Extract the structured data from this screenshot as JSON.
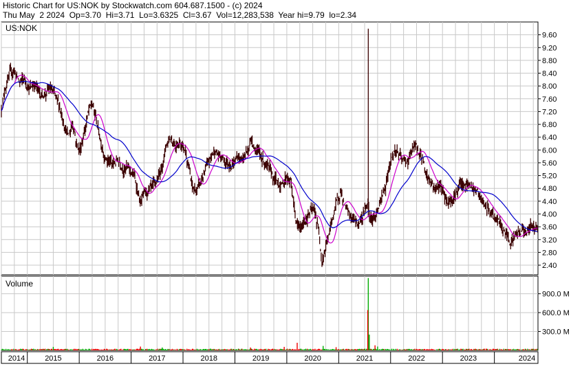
{
  "header": {
    "line1": "Historic Chart for US:NOK by Stockwatch.com 604.687.1500 - (c) 2024",
    "line2": "Thu May  2 2024  Op=3.70  Hi=3.71  Lo=3.6325  Cl=3.67  Vol=12,283,538  Year hi=9.79  lo=2.34"
  },
  "colors": {
    "candle": "#3a0000",
    "ma_short": "#cc00cc",
    "ma_long": "#0000cc",
    "vol_up": "#00aa00",
    "vol_down": "#ee0000",
    "grid": "#c8c8c8",
    "frame": "#000000"
  },
  "chart_data": [
    {
      "type": "line",
      "panel_label": "US:NOK",
      "y_ticks": [
        "9.60",
        "9.20",
        "8.80",
        "8.40",
        "8.00",
        "7.60",
        "7.20",
        "6.80",
        "6.40",
        "6.00",
        "5.60",
        "5.20",
        "4.80",
        "4.40",
        "4.00",
        "3.60",
        "3.20",
        "2.80",
        "2.40"
      ],
      "ylim": [
        2.1,
        10.0
      ],
      "x_ticks": [
        "2014",
        "2015",
        "2016",
        "2017",
        "2018",
        "2019",
        "2020",
        "2021",
        "2022",
        "2023",
        "2024"
      ],
      "x_tick_values": [
        2014.0,
        2015.0,
        2016.0,
        2017.0,
        2018.0,
        2019.0,
        2020.0,
        2021.0,
        2022.0,
        2023.0,
        2024.0
      ],
      "xlim": [
        2014.0,
        2024.34
      ],
      "price_series": [
        [
          2014.0,
          7.3
        ],
        [
          2014.08,
          8.0
        ],
        [
          2014.15,
          8.3
        ],
        [
          2014.25,
          8.5
        ],
        [
          2014.35,
          8.1
        ],
        [
          2014.45,
          8.2
        ],
        [
          2014.55,
          7.9
        ],
        [
          2014.65,
          8.1
        ],
        [
          2014.75,
          7.7
        ],
        [
          2014.85,
          7.8
        ],
        [
          2014.95,
          7.9
        ],
        [
          2015.05,
          7.6
        ],
        [
          2015.15,
          7.2
        ],
        [
          2015.22,
          6.8
        ],
        [
          2015.3,
          6.4
        ],
        [
          2015.38,
          6.9
        ],
        [
          2015.45,
          6.2
        ],
        [
          2015.52,
          6.0
        ],
        [
          2015.6,
          6.6
        ],
        [
          2015.68,
          7.2
        ],
        [
          2015.75,
          7.4
        ],
        [
          2015.82,
          7.0
        ],
        [
          2015.9,
          6.4
        ],
        [
          2015.98,
          5.9
        ],
        [
          2016.05,
          5.7
        ],
        [
          2016.15,
          5.5
        ],
        [
          2016.25,
          5.7
        ],
        [
          2016.35,
          5.5
        ],
        [
          2016.45,
          5.4
        ],
        [
          2016.55,
          5.2
        ],
        [
          2016.62,
          4.8
        ],
        [
          2016.68,
          4.3
        ],
        [
          2016.75,
          4.6
        ],
        [
          2016.85,
          4.7
        ],
        [
          2016.95,
          4.8
        ],
        [
          2017.05,
          5.2
        ],
        [
          2017.12,
          5.7
        ],
        [
          2017.18,
          6.2
        ],
        [
          2017.25,
          6.4
        ],
        [
          2017.35,
          6.2
        ],
        [
          2017.45,
          6.3
        ],
        [
          2017.55,
          6.0
        ],
        [
          2017.62,
          5.4
        ],
        [
          2017.68,
          4.8
        ],
        [
          2017.75,
          4.7
        ],
        [
          2017.85,
          5.0
        ],
        [
          2017.95,
          5.4
        ],
        [
          2018.05,
          5.8
        ],
        [
          2018.12,
          6.0
        ],
        [
          2018.2,
          5.8
        ],
        [
          2018.28,
          5.7
        ],
        [
          2018.38,
          5.6
        ],
        [
          2018.48,
          5.6
        ],
        [
          2018.55,
          5.8
        ],
        [
          2018.65,
          5.7
        ],
        [
          2018.75,
          6.0
        ],
        [
          2018.82,
          6.4
        ],
        [
          2018.88,
          6.1
        ],
        [
          2018.95,
          5.9
        ],
        [
          2019.05,
          5.7
        ],
        [
          2019.12,
          5.5
        ],
        [
          2019.2,
          5.2
        ],
        [
          2019.3,
          5.0
        ],
        [
          2019.4,
          4.9
        ],
        [
          2019.5,
          5.2
        ],
        [
          2019.58,
          5.0
        ],
        [
          2019.64,
          4.2
        ],
        [
          2019.7,
          3.6
        ],
        [
          2019.78,
          3.5
        ],
        [
          2019.85,
          3.8
        ],
        [
          2019.92,
          4.0
        ],
        [
          2019.98,
          4.1
        ],
        [
          2020.05,
          4.0
        ],
        [
          2020.12,
          3.4
        ],
        [
          2020.18,
          2.6
        ],
        [
          2020.25,
          3.0
        ],
        [
          2020.32,
          3.4
        ],
        [
          2020.4,
          4.0
        ],
        [
          2020.48,
          4.4
        ],
        [
          2020.55,
          4.8
        ],
        [
          2020.58,
          4.4
        ],
        [
          2020.65,
          4.1
        ],
        [
          2020.72,
          3.9
        ],
        [
          2020.8,
          3.8
        ],
        [
          2020.88,
          3.7
        ],
        [
          2020.95,
          3.9
        ],
        [
          2021.0,
          4.1
        ],
        [
          2021.06,
          4.4
        ],
        [
          2021.1,
          4.0
        ],
        [
          2021.18,
          3.9
        ],
        [
          2021.25,
          4.1
        ],
        [
          2021.32,
          4.4
        ],
        [
          2021.4,
          4.8
        ],
        [
          2021.48,
          5.6
        ],
        [
          2021.55,
          5.9
        ],
        [
          2021.62,
          6.0
        ],
        [
          2021.7,
          5.7
        ],
        [
          2021.78,
          5.6
        ],
        [
          2021.85,
          5.7
        ],
        [
          2021.92,
          6.0
        ],
        [
          2021.98,
          6.1
        ],
        [
          2022.05,
          5.9
        ],
        [
          2022.12,
          5.7
        ],
        [
          2022.2,
          5.2
        ],
        [
          2022.28,
          5.0
        ],
        [
          2022.36,
          4.8
        ],
        [
          2022.44,
          4.9
        ],
        [
          2022.52,
          4.7
        ],
        [
          2022.6,
          4.4
        ],
        [
          2022.68,
          4.5
        ],
        [
          2022.76,
          4.7
        ],
        [
          2022.84,
          4.9
        ],
        [
          2022.92,
          4.8
        ],
        [
          2023.0,
          4.9
        ],
        [
          2023.08,
          4.8
        ],
        [
          2023.16,
          4.7
        ],
        [
          2023.24,
          4.4
        ],
        [
          2023.32,
          4.2
        ],
        [
          2023.4,
          4.1
        ],
        [
          2023.48,
          3.9
        ],
        [
          2023.56,
          3.8
        ],
        [
          2023.64,
          3.6
        ],
        [
          2023.72,
          3.4
        ],
        [
          2023.8,
          3.2
        ],
        [
          2023.88,
          3.3
        ],
        [
          2023.96,
          3.4
        ],
        [
          2024.04,
          3.5
        ],
        [
          2024.12,
          3.5
        ],
        [
          2024.2,
          3.6
        ],
        [
          2024.28,
          3.6
        ],
        [
          2024.33,
          3.67
        ]
      ],
      "spikes": [
        {
          "x": 2021.07,
          "high": 9.79,
          "low": 3.9
        }
      ]
    },
    {
      "type": "bar",
      "panel_label": "Volume",
      "y_ticks": [
        "900.0 M",
        "600.0 M",
        "300.0 M"
      ],
      "y_tick_values": [
        900,
        600,
        300
      ],
      "ylim": [
        0,
        1180
      ],
      "unit": "M",
      "baseline": 15,
      "spikes": [
        {
          "x": 2021.07,
          "value": 1150,
          "up": true
        },
        {
          "x": 2021.06,
          "value": 640,
          "up": false
        },
        {
          "x": 2021.09,
          "value": 250,
          "up": true
        },
        {
          "x": 2019.7,
          "value": 120,
          "up": false
        },
        {
          "x": 2016.68,
          "value": 60,
          "up": false
        },
        {
          "x": 2019.45,
          "value": 55,
          "up": false
        },
        {
          "x": 2018.8,
          "value": 45,
          "up": false
        },
        {
          "x": 2020.2,
          "value": 70,
          "up": true
        },
        {
          "x": 2015.0,
          "value": 55,
          "up": true
        },
        {
          "x": 2021.2,
          "value": 80,
          "up": false
        },
        {
          "x": 2021.25,
          "value": 60,
          "up": true
        },
        {
          "x": 2017.1,
          "value": 45,
          "up": true
        },
        {
          "x": 2020.45,
          "value": 50,
          "up": false
        }
      ]
    }
  ]
}
